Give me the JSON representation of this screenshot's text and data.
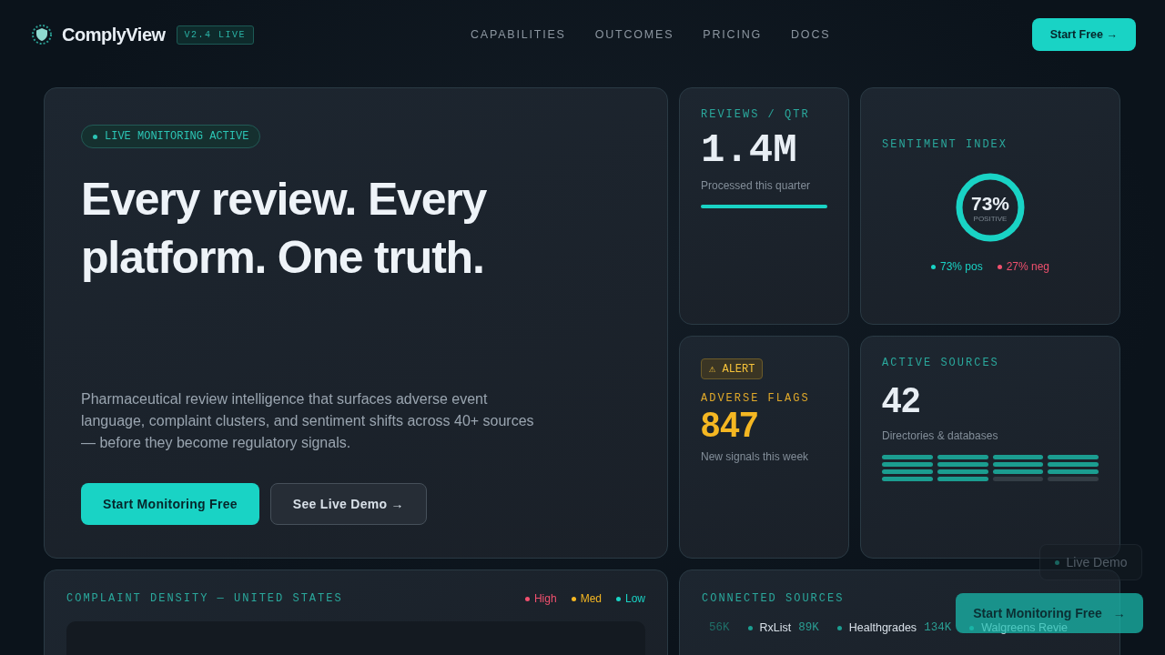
{
  "nav": {
    "brand": "ComplyView",
    "version": "V2.4 LIVE",
    "links": [
      "CAPABILITIES",
      "OUTCOMES",
      "PRICING",
      "DOCS"
    ],
    "cta": "Start Free →"
  },
  "hero": {
    "status": "LIVE MONITORING ACTIVE",
    "headline": "Every review. Every platform. One truth.",
    "body": "Pharmaceutical review intelligence that surfaces adverse event language, complaint clusters, and sentiment shifts across 40+ sources — before they become regulatory signals.",
    "primary": "Start Monitoring Free",
    "secondary": "See Live Demo",
    "secondary_arrow": "→"
  },
  "reviews": {
    "label": "REVIEWS / QTR",
    "value": "1.4M",
    "caption": "Processed this quarter",
    "level": 1
  },
  "sentiment": {
    "label": "SENTIMENT INDEX",
    "value": "73%",
    "sub": "POSITIVE",
    "level": 1,
    "legend": [
      {
        "text": "73% pos",
        "color": "#19d3c5"
      },
      {
        "text": "27% neg",
        "color": "#f0506e"
      }
    ]
  },
  "alert": {
    "badge": "⚠ ALERT",
    "label": "ADVERSE FLAGS",
    "value": "847",
    "caption": "New signals this week"
  },
  "sources": {
    "label": "ACTIVE SOURCES",
    "value": "42",
    "caption": "Directories & databases",
    "segments": [
      {
        "on": true
      },
      {
        "on": true
      },
      {
        "on": true
      },
      {
        "on": true
      },
      {
        "on": true
      },
      {
        "on": true
      },
      {
        "on": true
      },
      {
        "on": true
      },
      {
        "on": true
      },
      {
        "on": true
      },
      {
        "on": true
      },
      {
        "on": true
      },
      {
        "on": true
      },
      {
        "on": true
      },
      {
        "on": false
      },
      {
        "on": false
      }
    ]
  },
  "density": {
    "title": "COMPLAINT DENSITY — UNITED STATES",
    "legend": [
      {
        "text": "High",
        "color": "#f0506e"
      },
      {
        "text": "Med",
        "color": "#f5b722"
      },
      {
        "text": "Low",
        "color": "#19d3c5"
      }
    ]
  },
  "connected": {
    "title": "CONNECTED SOURCES",
    "items": [
      {
        "count": "56K"
      },
      {
        "name": "RxList",
        "count": "89K"
      },
      {
        "name": "Healthgrades",
        "count": "134K"
      },
      {
        "name": "Walgreens Revie"
      }
    ]
  },
  "floating": {
    "demo": "Live Demo",
    "start": "Start Monitoring Free",
    "start_arrow": "→"
  }
}
